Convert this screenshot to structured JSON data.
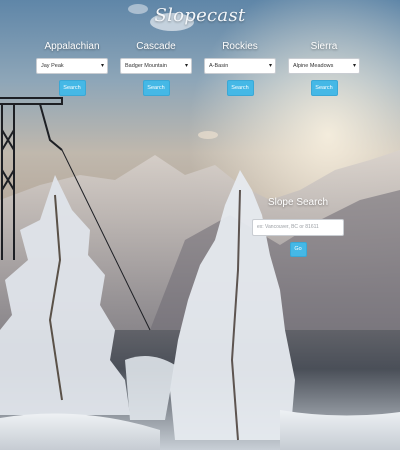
{
  "app": {
    "title": "Slopecast"
  },
  "regions": [
    {
      "label": "Appalachian",
      "selected": "Jay Peak",
      "button_label": "Search"
    },
    {
      "label": "Cascade",
      "selected": "Badger Mountain",
      "button_label": "Search"
    },
    {
      "label": "Rockies",
      "selected": "A-Basin",
      "button_label": "Search"
    },
    {
      "label": "Sierra",
      "selected": "Alpine Meadows",
      "button_label": "Search"
    }
  ],
  "slope_search": {
    "title": "Slope Search",
    "placeholder": "ex: Vancouver, BC or 81611",
    "button_label": "Go"
  },
  "icons": {
    "dropdown": "chevron-down-icon"
  },
  "colors": {
    "accent": "#45b8e6",
    "title_text": "#f4f7fa"
  }
}
